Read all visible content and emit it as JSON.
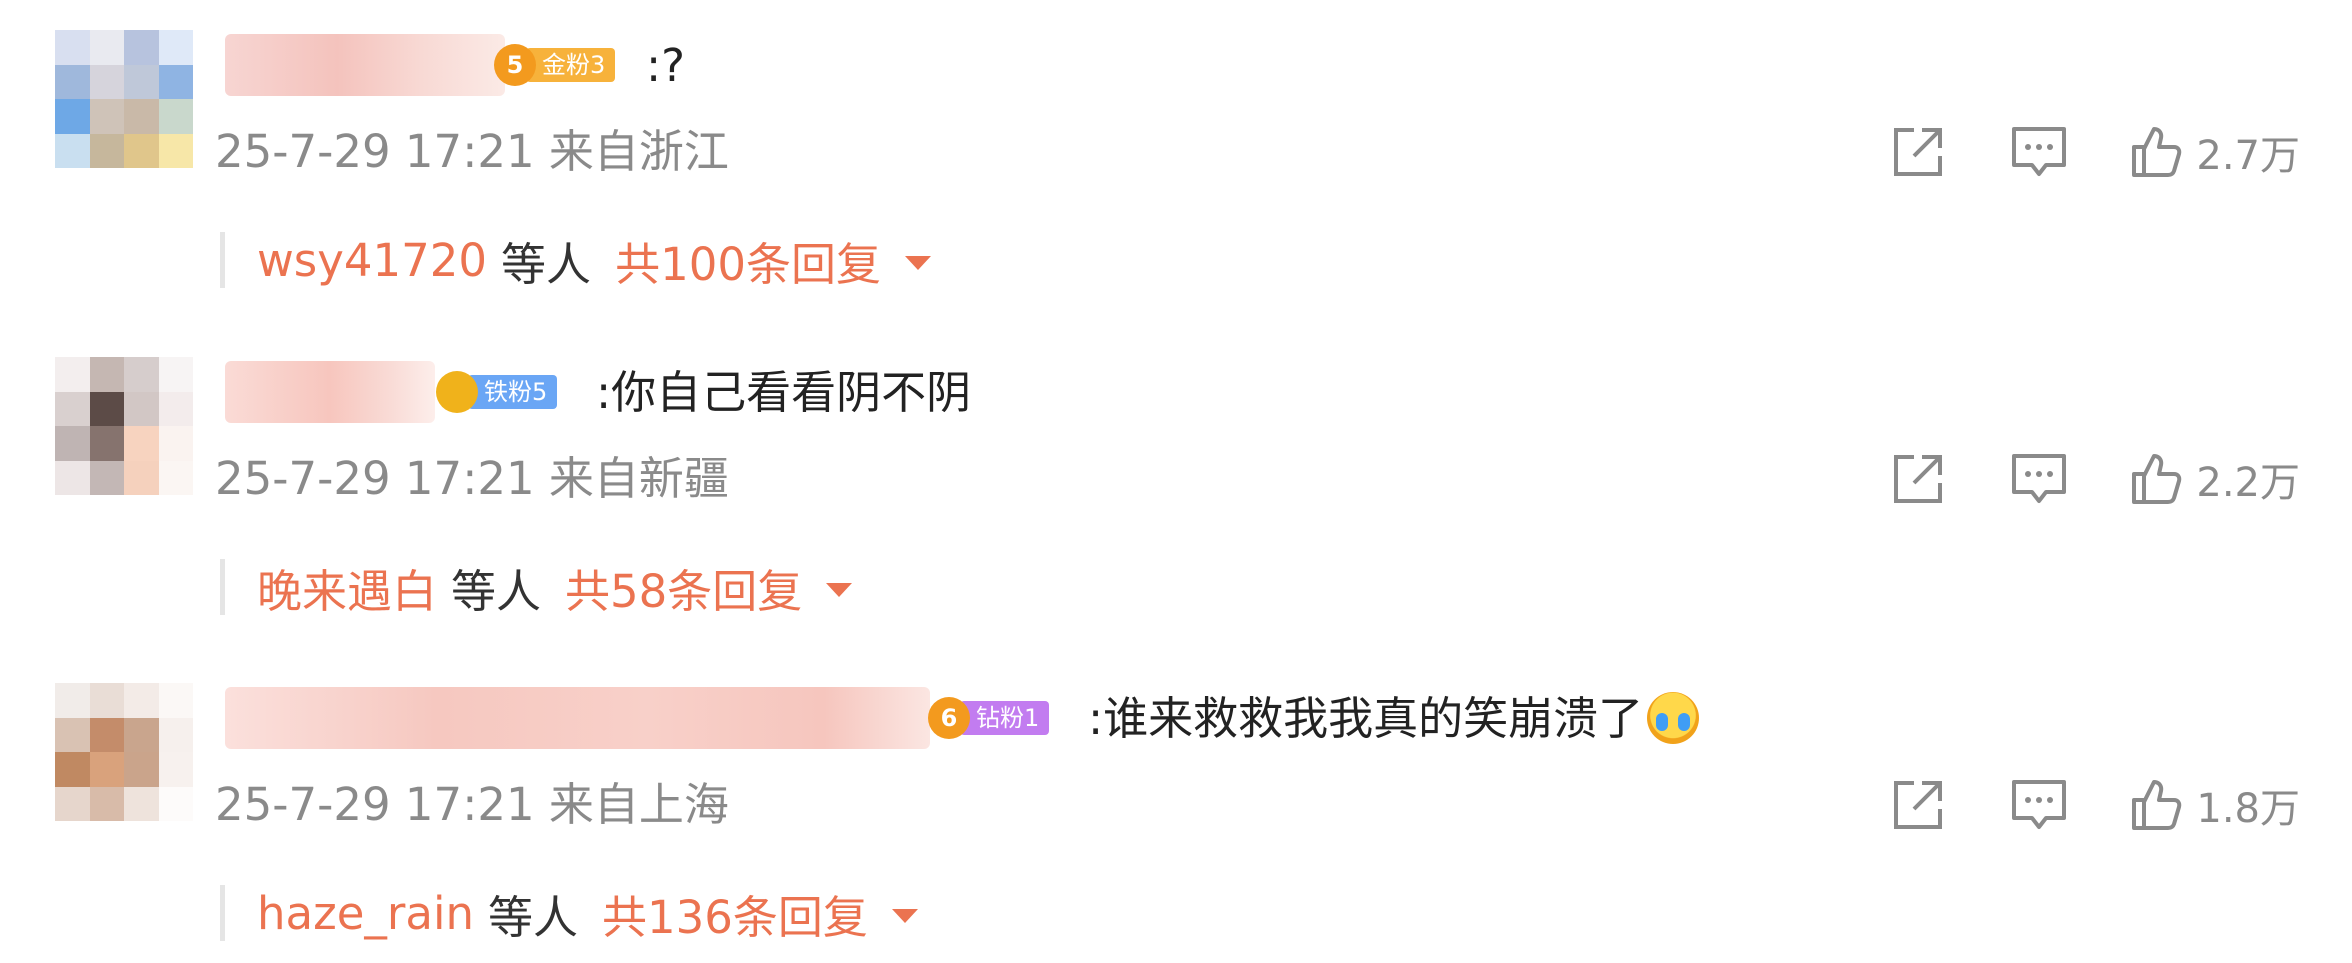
{
  "comments": [
    {
      "fan_badge": {
        "label": "金粉3",
        "level": "5",
        "color": "#f7b23b",
        "crown_color": "#f39a1e"
      },
      "text": ":?",
      "meta": "25-7-29 17:21 来自浙江",
      "likes": "2.7万",
      "replies": {
        "users": "wsy41720",
        "etc": "等人",
        "count": "共100条回复"
      }
    },
    {
      "fan_badge": {
        "label": "铁粉5",
        "level": "",
        "color": "#6aa6f5",
        "crown_color": "#f0b21b"
      },
      "text": ":你自己看看阴不阴",
      "meta": "25-7-29 17:21 来自新疆",
      "likes": "2.2万",
      "replies": {
        "users": "晚来遇白",
        "etc": "等人",
        "count": "共58条回复"
      }
    },
    {
      "fan_badge": {
        "label": "钻粉1",
        "level": "6",
        "color": "#c27cf0",
        "crown_color": "#f39a1e"
      },
      "text": ":谁来救救我我真的笑崩溃了",
      "emoji": "crying-laughing-emoji",
      "meta": "25-7-29 17:21 来自上海",
      "likes": "1.8万",
      "replies": {
        "users": "haze_rain",
        "etc": "等人",
        "count": "共136条回复"
      }
    }
  ],
  "icons": {
    "share": "share-icon",
    "comment": "comment-icon",
    "like": "thumbs-up-icon"
  },
  "colors": {
    "accent": "#eb7350",
    "meta": "#8a8a8a"
  }
}
